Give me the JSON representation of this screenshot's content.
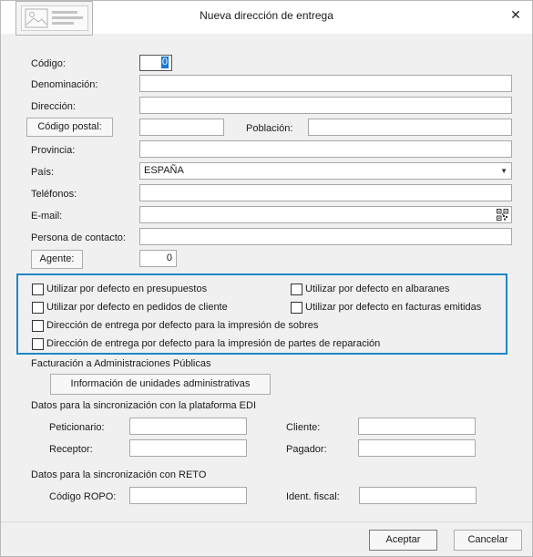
{
  "window": {
    "title": "Nueva dirección de entrega",
    "close_glyph": "✕"
  },
  "form": {
    "codigo": {
      "label": "Código:",
      "value": "0"
    },
    "denominacion": {
      "label": "Denominación:",
      "value": ""
    },
    "direccion": {
      "label": "Dirección:",
      "value": ""
    },
    "codigo_postal": {
      "button": "Código postal:",
      "value": ""
    },
    "poblacion": {
      "label": "Población:",
      "value": ""
    },
    "provincia": {
      "label": "Provincia:",
      "value": ""
    },
    "pais": {
      "label": "País:",
      "value": "ESPAÑA"
    },
    "telefonos": {
      "label": "Teléfonos:",
      "value": ""
    },
    "email": {
      "label": "E-mail:",
      "value": ""
    },
    "persona_contacto": {
      "label": "Persona de contacto:",
      "value": ""
    },
    "agente": {
      "button": "Agente:",
      "value": "0"
    }
  },
  "options": {
    "presupuestos": {
      "label": "Utilizar por defecto en presupuestos",
      "checked": false
    },
    "albaranes": {
      "label": "Utilizar por defecto en albaranes",
      "checked": false
    },
    "pedidos": {
      "label": "Utilizar por defecto en pedidos de cliente",
      "checked": false
    },
    "facturas": {
      "label": "Utilizar por defecto en facturas emitidas",
      "checked": false
    },
    "sobres": {
      "label": "Dirección de entrega por defecto para la impresión de sobres",
      "checked": false
    },
    "partes": {
      "label": "Dirección de entrega por defecto para la impresión de partes de reparación",
      "checked": false
    }
  },
  "administraciones": {
    "heading": "Facturación a Administraciones Públicas",
    "button": "Información de unidades administrativas"
  },
  "edi": {
    "heading": "Datos para la sincronización con la plataforma EDI",
    "peticionario": {
      "label": "Peticionario:",
      "value": ""
    },
    "cliente": {
      "label": "Cliente:",
      "value": ""
    },
    "receptor": {
      "label": "Receptor:",
      "value": ""
    },
    "pagador": {
      "label": "Pagador:",
      "value": ""
    }
  },
  "reto": {
    "heading": "Datos para la sincronización con RETO",
    "codigo_ropo": {
      "label": "Código ROPO:",
      "value": ""
    },
    "ident_fiscal": {
      "label": "Ident. fiscal:",
      "value": ""
    }
  },
  "footer": {
    "accept": "Aceptar",
    "cancel": "Cancelar"
  },
  "colors": {
    "group_border": "#1e86c5",
    "focus_highlight": "#1978d2"
  },
  "icons": [
    "address-card-icon",
    "close-icon",
    "dropdown-arrow-icon",
    "qr-code-icon"
  ]
}
